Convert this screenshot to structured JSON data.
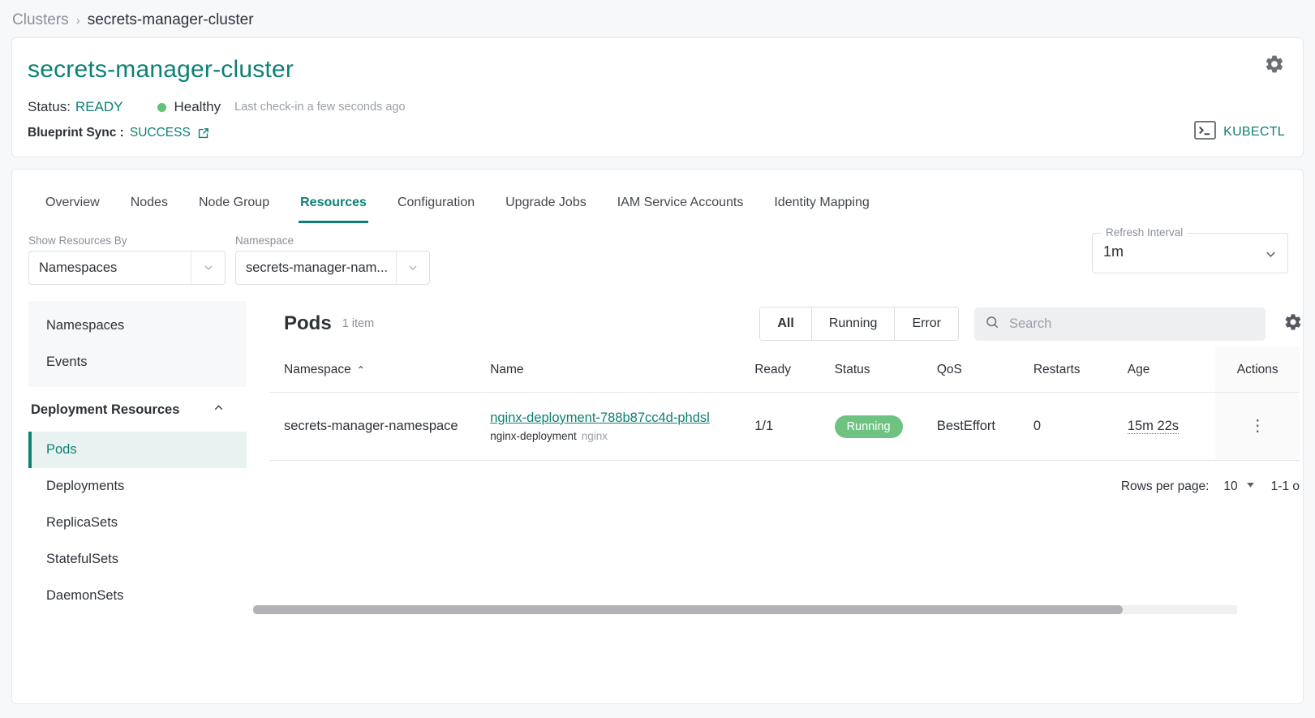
{
  "breadcrumb": {
    "root": "Clusters",
    "separator": "›",
    "current": "secrets-manager-cluster"
  },
  "cluster": {
    "name": "secrets-manager-cluster",
    "status_label": "Status:",
    "status_value": "READY",
    "health_text": "Healthy",
    "checkin_text": "Last check-in a few seconds ago",
    "sync_label": "Blueprint Sync :",
    "sync_value": "SUCCESS",
    "kubectl_label": "KUBECTL",
    "accent_color": "#0e8074",
    "health_color": "#63c277"
  },
  "tabs": [
    {
      "label": "Overview",
      "active": false
    },
    {
      "label": "Nodes",
      "active": false
    },
    {
      "label": "Node Group",
      "active": false
    },
    {
      "label": "Resources",
      "active": true
    },
    {
      "label": "Configuration",
      "active": false
    },
    {
      "label": "Upgrade Jobs",
      "active": false
    },
    {
      "label": "IAM Service Accounts",
      "active": false
    },
    {
      "label": "Identity Mapping",
      "active": false
    }
  ],
  "filters": {
    "show_by_label": "Show Resources By",
    "show_by_value": "Namespaces",
    "namespace_label": "Namespace",
    "namespace_value": "secrets-manager-nam...",
    "refresh_label": "Refresh Interval",
    "refresh_value": "1m"
  },
  "sidebar": {
    "top_items": [
      {
        "label": "Namespaces"
      },
      {
        "label": "Events"
      }
    ],
    "section_title": "Deployment Resources",
    "items": [
      {
        "label": "Pods",
        "active": true
      },
      {
        "label": "Deployments",
        "active": false
      },
      {
        "label": "ReplicaSets",
        "active": false
      },
      {
        "label": "StatefulSets",
        "active": false
      },
      {
        "label": "DaemonSets",
        "active": false
      }
    ]
  },
  "table": {
    "title": "Pods",
    "count_text": "1 item",
    "segments": [
      {
        "label": "All",
        "active": true
      },
      {
        "label": "Running",
        "active": false
      },
      {
        "label": "Error",
        "active": false
      }
    ],
    "search_placeholder": "Search",
    "search_value": "",
    "columns": [
      {
        "label": "Namespace",
        "sorted": true,
        "sort_caret": "⌃"
      },
      {
        "label": "Name",
        "sorted": false
      },
      {
        "label": "Ready",
        "sorted": false
      },
      {
        "label": "Status",
        "sorted": false
      },
      {
        "label": "QoS",
        "sorted": false
      },
      {
        "label": "Restarts",
        "sorted": false
      },
      {
        "label": "Age",
        "sorted": false
      },
      {
        "label": "Actions",
        "sorted": false
      }
    ],
    "rows": [
      {
        "namespace": "secrets-manager-namespace",
        "name": "nginx-deployment-788b87cc4d-phdsl",
        "owner": "nginx-deployment",
        "container": "nginx",
        "ready": "1/1",
        "status": "Running",
        "qos": "BestEffort",
        "restarts": "0",
        "age": "15m 22s"
      }
    ],
    "status_pill_color": "#6ec383"
  },
  "pagination": {
    "rows_per_page_label": "Rows per page:",
    "rows_per_page_value": "10",
    "range_text": "1-1 o"
  }
}
